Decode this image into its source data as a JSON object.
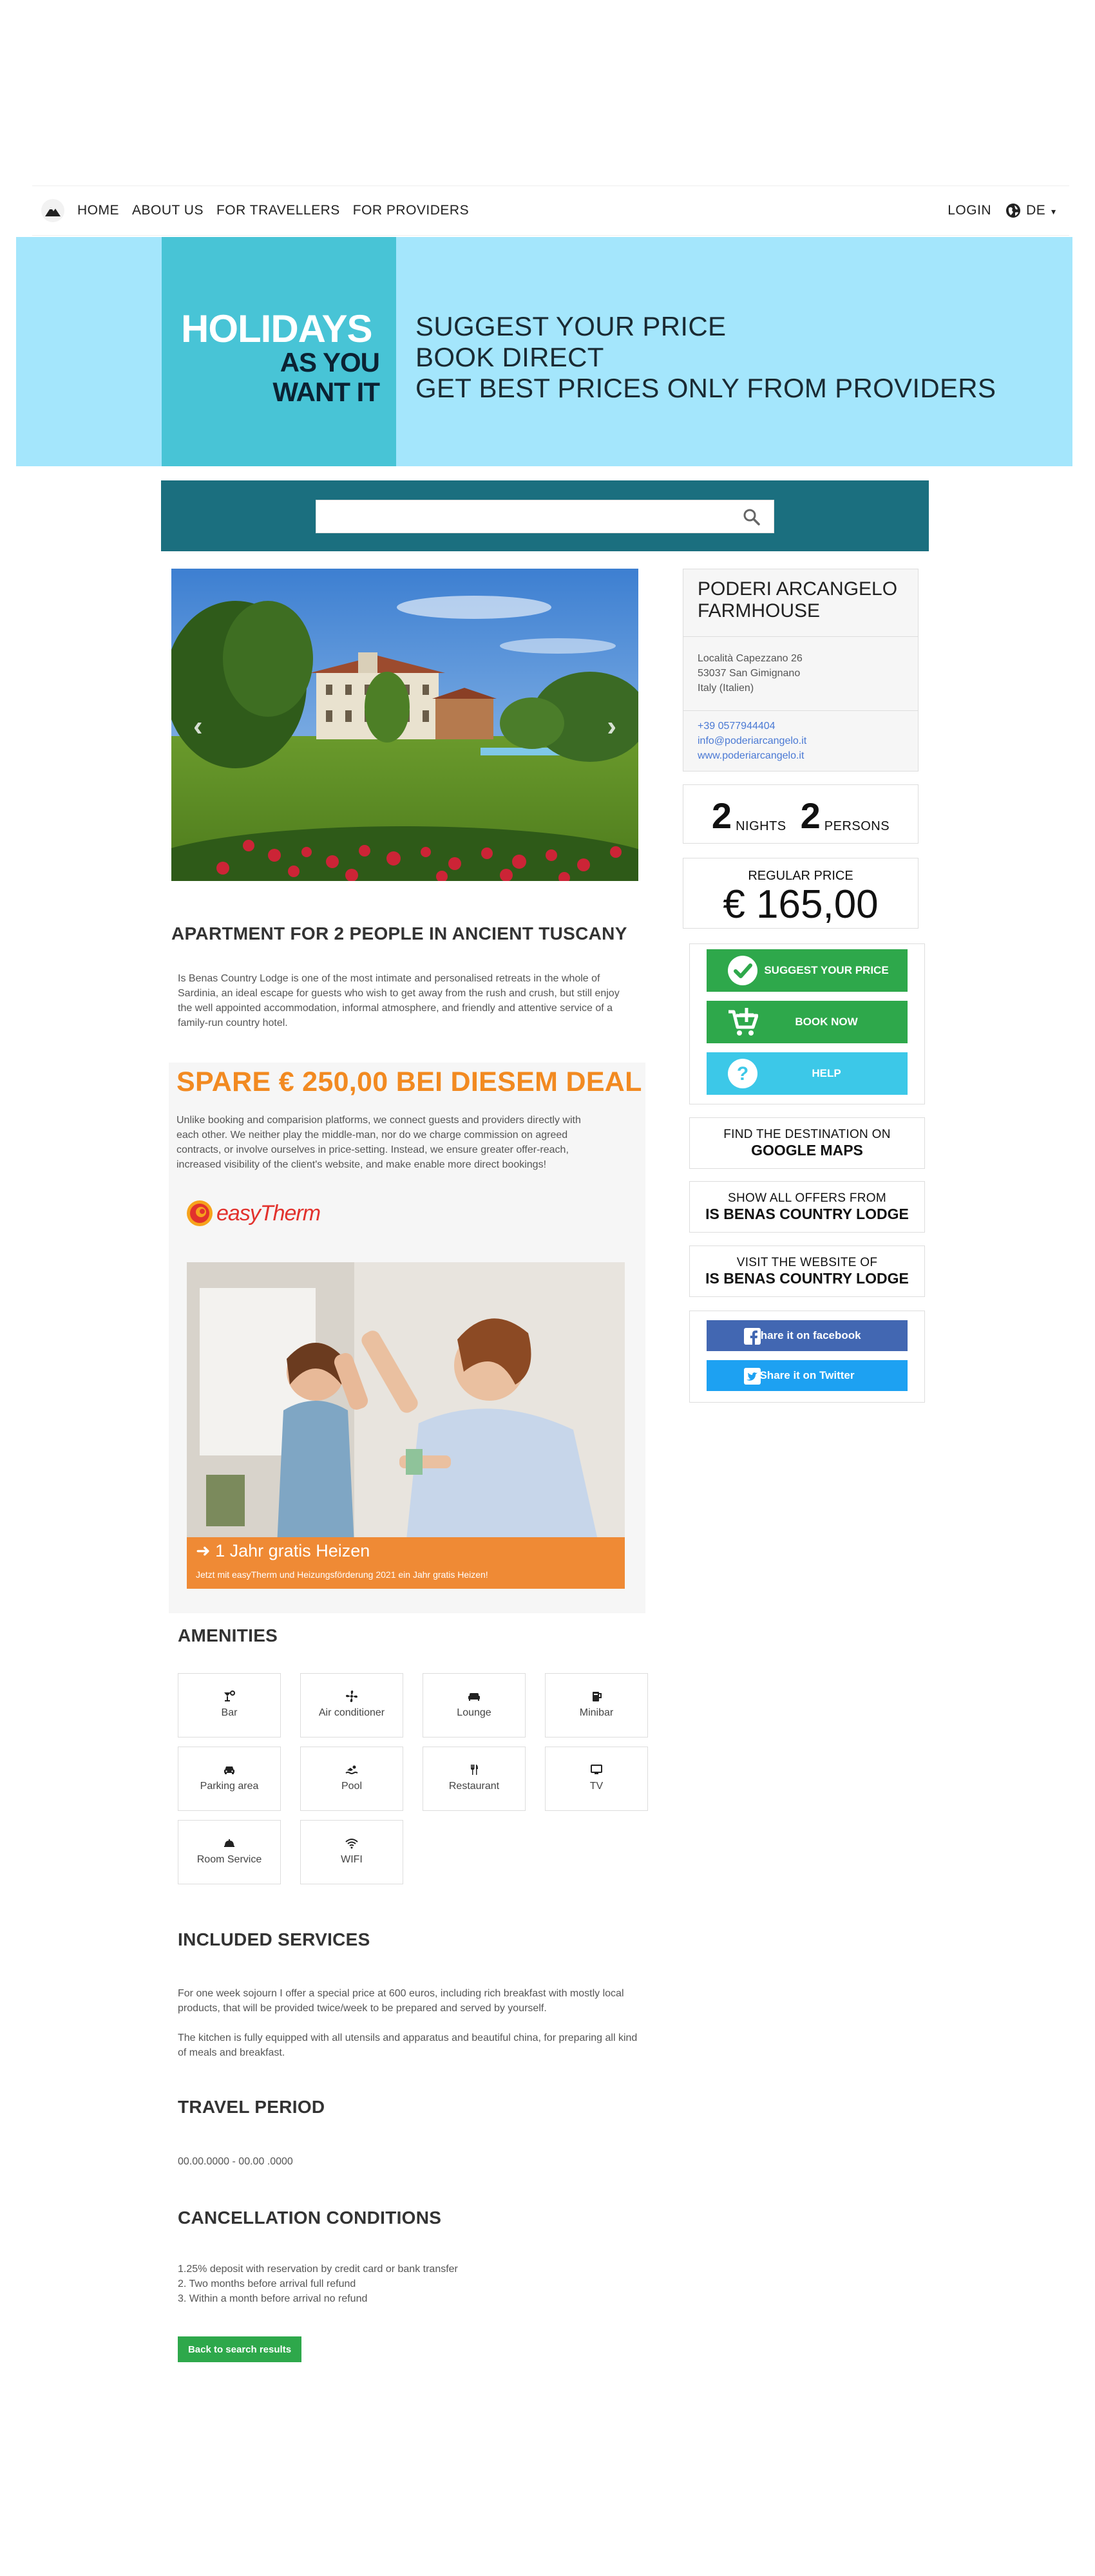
{
  "nav": {
    "items": [
      "HOME",
      "ABOUT US",
      "FOR TRAVELLERS",
      "FOR PROVIDERS"
    ],
    "login": "LOGIN",
    "language": "DE"
  },
  "hero": {
    "line1": "HOLIDAYS",
    "line2": "AS YOU",
    "line3": "WANT IT",
    "tagline": [
      "SUGGEST YOUR PRICE",
      "BOOK DIRECT",
      "GET BEST PRICES ONLY FROM PROVIDERS"
    ]
  },
  "search": {
    "value": "",
    "placeholder": ""
  },
  "provider": {
    "name_line1": "PODERI ARCANGELO",
    "name_line2": "FARMHOUSE",
    "address": [
      "Località Capezzano 26",
      "53037 San Gimignano",
      "Italy (Italien)"
    ],
    "phone": "+39 0577944404",
    "email": "info@poderiarcangelo.it",
    "website": "www.poderiarcangelo.it"
  },
  "stay": {
    "nights": "2",
    "nights_label": "NIGHTS",
    "persons": "2",
    "persons_label": "PERSONS"
  },
  "price": {
    "label": "REGULAR PRICE",
    "value": "€ 165,00"
  },
  "actions": {
    "suggest": "SUGGEST YOUR PRICE",
    "book": "BOOK NOW",
    "help": "HELP"
  },
  "links": {
    "maps_a": "FIND THE DESTINATION ON",
    "maps_b": "GOOGLE MAPS",
    "offers_a": "SHOW ALL OFFERS FROM",
    "offers_b": "IS BENAS COUNTRY LODGE",
    "website_a": "VISIT THE WEBSITE OF",
    "website_b": "IS BENAS COUNTRY LODGE"
  },
  "share": {
    "facebook": "Share it on facebook",
    "twitter": "Share it on Twitter"
  },
  "listing": {
    "title": "APARTMENT FOR 2 PEOPLE IN ANCIENT TUSCANY",
    "description": "Is Benas Country Lodge is one of the most intimate and personalised retreats in the whole of Sardinia, an ideal escape for guests who wish to get away from the rush and crush, but still enjoy the well appointed accommodation, informal atmosphere, and friendly and attentive service of a family-run country hotel."
  },
  "deal": {
    "title": "SPARE € 250,00 BEI DIESEM DEAL",
    "text": "Unlike booking and comparision platforms, we connect guests and providers directly with each other. We neither play the middle-man, nor do we charge commission on agreed contracts, or involve ourselves in price-setting. Instead, we ensure greater offer-reach, increased visibility of the client's website, and make enable more direct bookings!",
    "brand": "easyTherm",
    "banner_title": "1 Jahr gratis Heizen",
    "banner_sub": "Jetzt mit easyTherm und Heizungsförderung 2021 ein Jahr gratis Heizen!"
  },
  "amenities": {
    "title": "AMENITIES",
    "items": [
      "Bar",
      "Air conditioner",
      "Lounge",
      "Minibar",
      "Parking area",
      "Pool",
      "Restaurant",
      "TV",
      "Room Service",
      "WIFI"
    ]
  },
  "services": {
    "title": "INCLUDED SERVICES",
    "p1": "For one week sojourn I offer a special price at 600 euros, including rich breakfast with mostly local products, that will be provided twice/week to be prepared and served by yourself.",
    "p2": "The kitchen is fully equipped with all utensils and apparatus and beautiful china, for preparing all kind of meals and breakfast."
  },
  "period": {
    "title": "TRAVEL PERIOD",
    "value": "00.00.0000 - 00.00 .0000"
  },
  "cancellation": {
    "title": "CANCELLATION CONDITIONS",
    "lines": [
      "1.25% deposit with reservation by credit card or bank transfer",
      "2. Two months before arrival full refund",
      "3. Within a month before arrival no refund"
    ]
  },
  "back_button": "Back to search results",
  "colors": {
    "hero_bg": "#a4e6fc",
    "hero_box": "#48c4d6",
    "search_bg": "#1b6f7f",
    "green": "#2ea84b",
    "help": "#3cc8e8",
    "facebook": "#4267b2",
    "twitter": "#1da1f2",
    "deal_orange": "#f28a21"
  }
}
